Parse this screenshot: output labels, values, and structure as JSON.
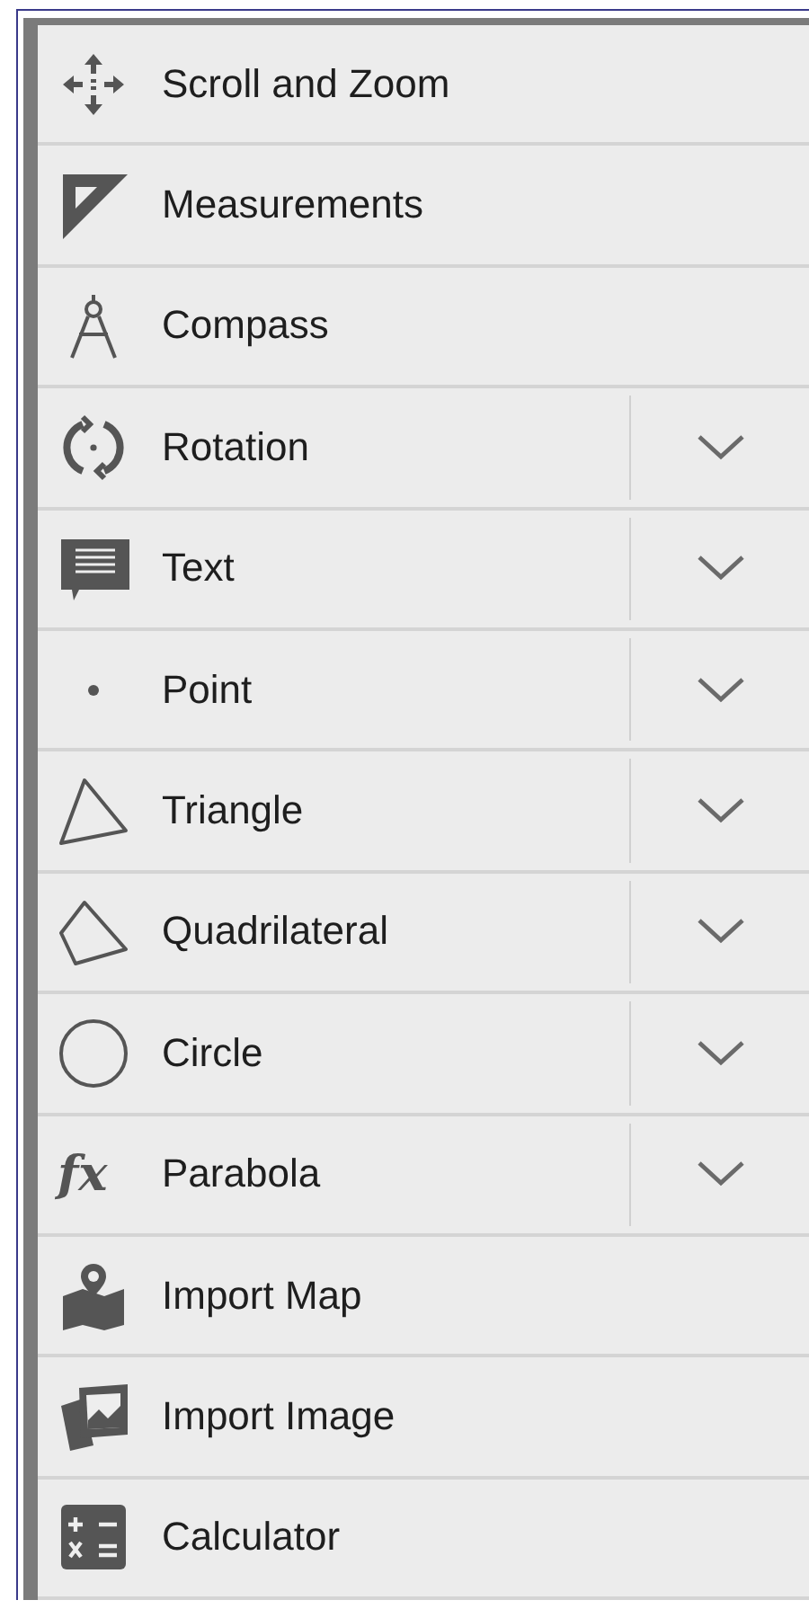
{
  "menu": {
    "items": [
      {
        "label": "Scroll and Zoom",
        "expandable": false
      },
      {
        "label": "Measurements",
        "expandable": false
      },
      {
        "label": "Compass",
        "expandable": false
      },
      {
        "label": "Rotation",
        "expandable": true
      },
      {
        "label": "Text",
        "expandable": true
      },
      {
        "label": "Point",
        "expandable": true
      },
      {
        "label": "Triangle",
        "expandable": true
      },
      {
        "label": "Quadrilateral",
        "expandable": true
      },
      {
        "label": "Circle",
        "expandable": true
      },
      {
        "label": "Parabola",
        "icon_text": "fx",
        "expandable": true
      },
      {
        "label": "Import Map",
        "expandable": false
      },
      {
        "label": "Import Image",
        "expandable": false
      },
      {
        "label": "Calculator",
        "expandable": false
      }
    ]
  }
}
